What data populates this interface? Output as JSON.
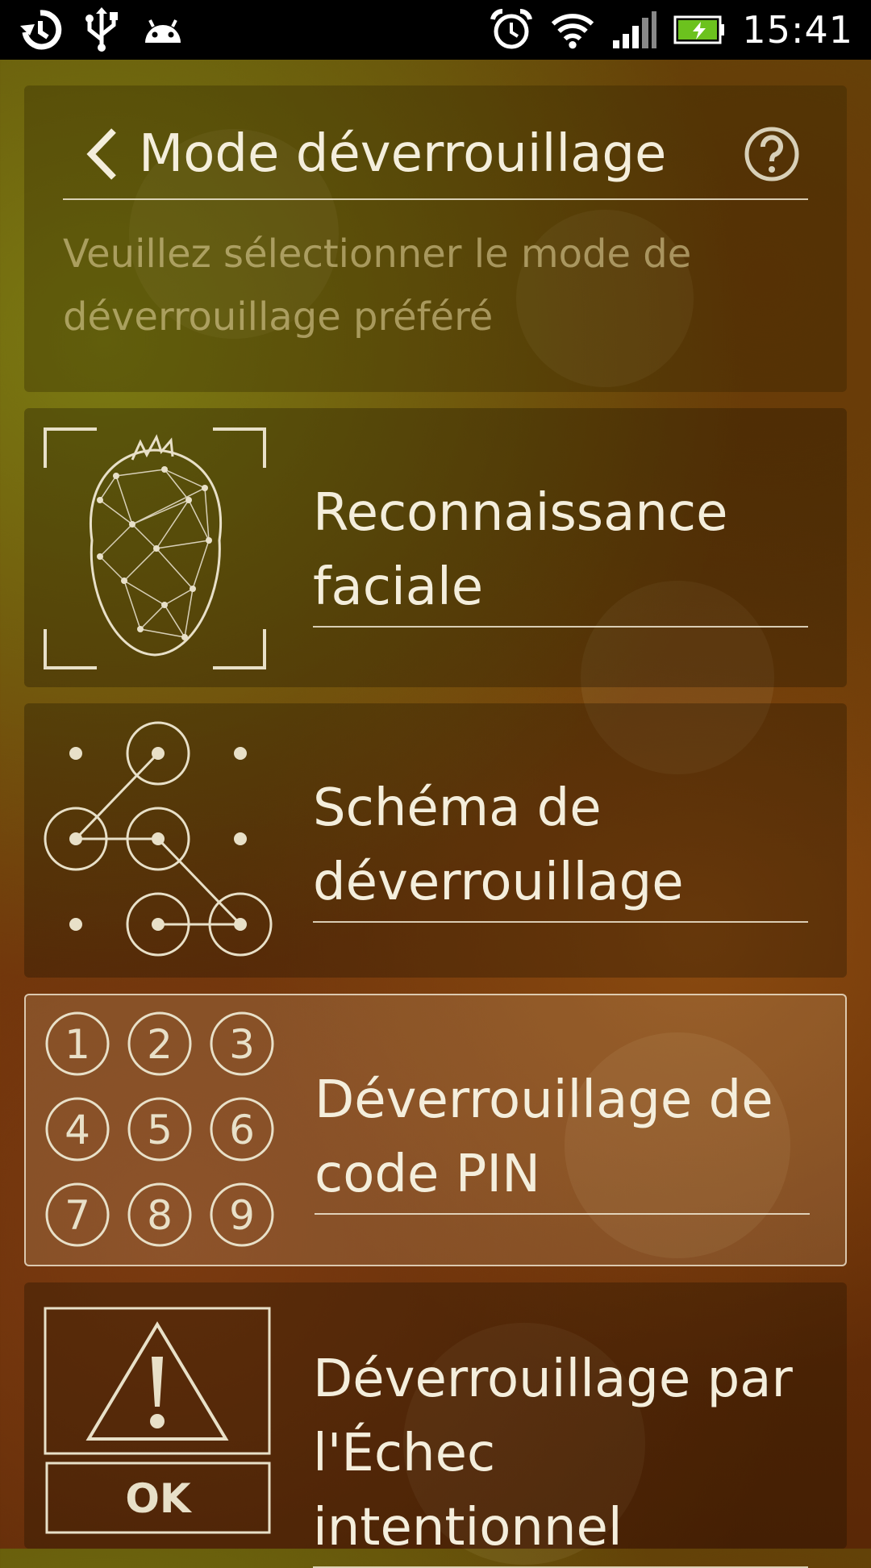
{
  "status_bar": {
    "time": "15:41",
    "left_icons": [
      "sync-icon",
      "usb-icon",
      "android-icon"
    ],
    "right_icons": [
      "alarm-icon",
      "wifi-icon",
      "signal-icon",
      "battery-charging-icon"
    ],
    "battery_color": "#6cc21e"
  },
  "header": {
    "title": "Mode déverrouillage",
    "subtitle": "Veuillez sélectionner le mode de déverrouillage préféré"
  },
  "options": [
    {
      "label": "Reconnaissance faciale",
      "icon": "face-recognition-icon",
      "selected": false
    },
    {
      "label": "Schéma de déverrouillage",
      "icon": "pattern-lock-icon",
      "selected": false
    },
    {
      "label": "Déverrouillage de code PIN",
      "icon": "pin-keypad-icon",
      "selected": true,
      "keys": [
        "1",
        "2",
        "3",
        "4",
        "5",
        "6",
        "7",
        "8",
        "9"
      ]
    },
    {
      "label": "Déverrouillage par l'Échec intentionnel",
      "icon": "warning-icon",
      "selected": false,
      "button_text": "OK"
    }
  ]
}
